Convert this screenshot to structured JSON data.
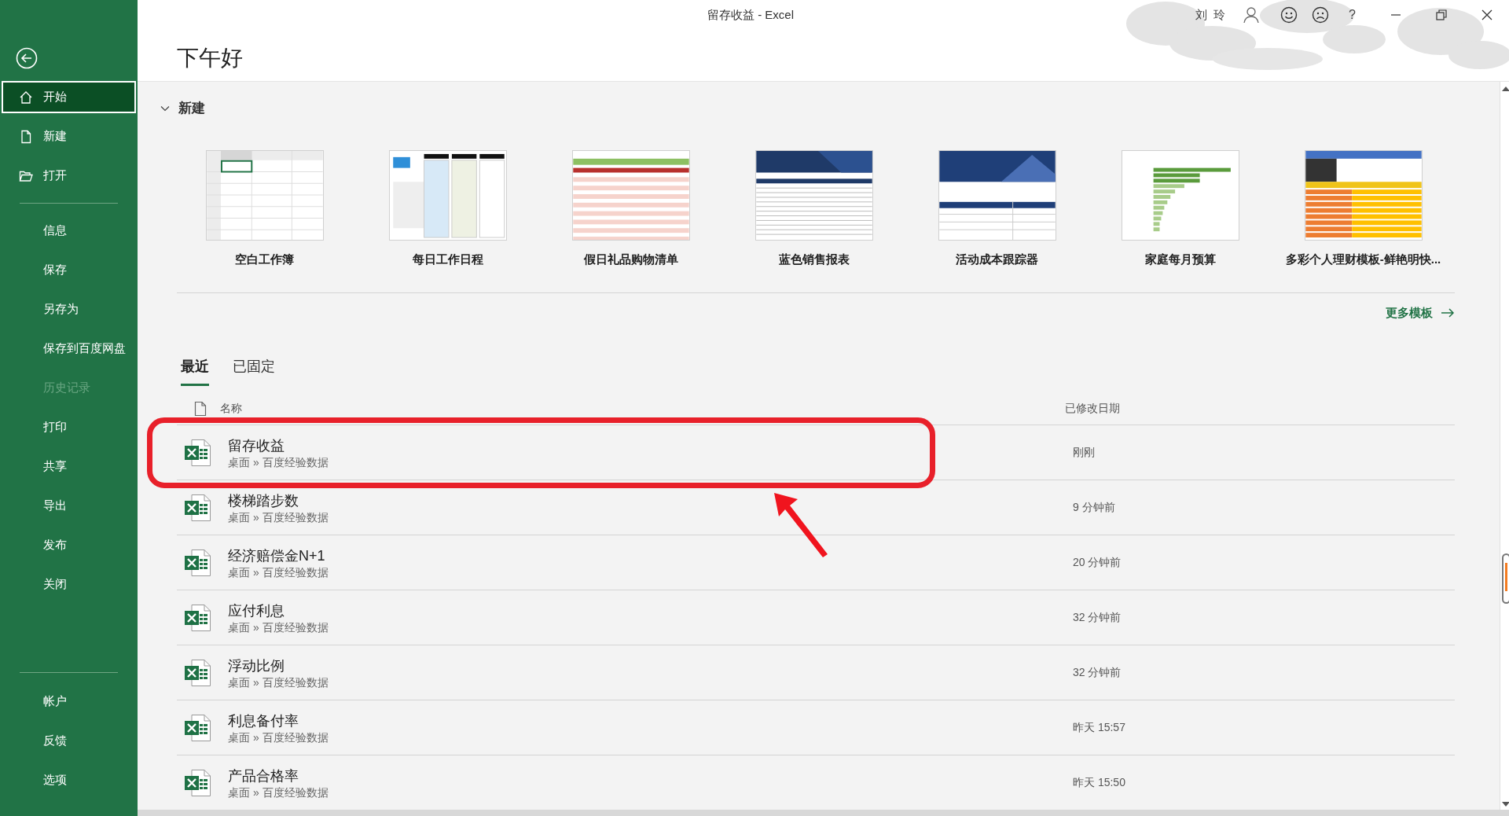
{
  "title_bar": {
    "title": "留存收益 - Excel",
    "user": "刘 玲",
    "help": "?"
  },
  "sidebar": {
    "groups": [
      [
        {
          "label": "开始",
          "selected": true,
          "disabled": false
        },
        {
          "label": "新建",
          "selected": false,
          "disabled": false
        },
        {
          "label": "打开",
          "selected": false,
          "disabled": false
        }
      ],
      [
        {
          "label": "信息",
          "selected": false,
          "disabled": false
        },
        {
          "label": "保存",
          "selected": false,
          "disabled": false
        },
        {
          "label": "另存为",
          "selected": false,
          "disabled": false
        },
        {
          "label": "保存到百度网盘",
          "selected": false,
          "disabled": false
        },
        {
          "label": "历史记录",
          "selected": false,
          "disabled": true
        },
        {
          "label": "打印",
          "selected": false,
          "disabled": false
        },
        {
          "label": "共享",
          "selected": false,
          "disabled": false
        },
        {
          "label": "导出",
          "selected": false,
          "disabled": false
        },
        {
          "label": "发布",
          "selected": false,
          "disabled": false
        },
        {
          "label": "关闭",
          "selected": false,
          "disabled": false
        }
      ],
      [
        {
          "label": "帐户",
          "selected": false,
          "disabled": false
        },
        {
          "label": "反馈",
          "selected": false,
          "disabled": false
        },
        {
          "label": "选项",
          "selected": false,
          "disabled": false
        }
      ]
    ]
  },
  "greeting": "下午好",
  "new_section": {
    "heading": "新建",
    "expanded": true,
    "templates": [
      {
        "label": "空白工作簿"
      },
      {
        "label": "每日工作日程"
      },
      {
        "label": "假日礼品购物清单"
      },
      {
        "label": "蓝色销售报表"
      },
      {
        "label": "活动成本跟踪器"
      },
      {
        "label": "家庭每月预算"
      },
      {
        "label": "多彩个人理财模板-鲜艳明快..."
      }
    ],
    "more_link": "更多模板"
  },
  "recent": {
    "tabs": [
      {
        "label": "最近",
        "selected": true
      },
      {
        "label": "已固定",
        "selected": false
      }
    ],
    "columns": [
      "名称",
      "已修改日期"
    ],
    "files": [
      {
        "name": "留存收益",
        "path": "桌面 » 百度经验数据",
        "modified": "刚刚",
        "highlighted": true
      },
      {
        "name": "楼梯踏步数",
        "path": "桌面 » 百度经验数据",
        "modified": "9 分钟前",
        "highlighted": false
      },
      {
        "name": "经济赔偿金N+1",
        "path": "桌面 » 百度经验数据",
        "modified": "20 分钟前",
        "highlighted": false
      },
      {
        "name": "应付利息",
        "path": "桌面 » 百度经验数据",
        "modified": "32 分钟前",
        "highlighted": false
      },
      {
        "name": "浮动比例",
        "path": "桌面 » 百度经验数据",
        "modified": "32 分钟前",
        "highlighted": false
      },
      {
        "name": "利息备付率",
        "path": "桌面 » 百度经验数据",
        "modified": "昨天 15:57",
        "highlighted": false
      },
      {
        "name": "产品合格率",
        "path": "桌面 » 百度经验数据",
        "modified": "昨天 15:50",
        "highlighted": false
      }
    ]
  }
}
